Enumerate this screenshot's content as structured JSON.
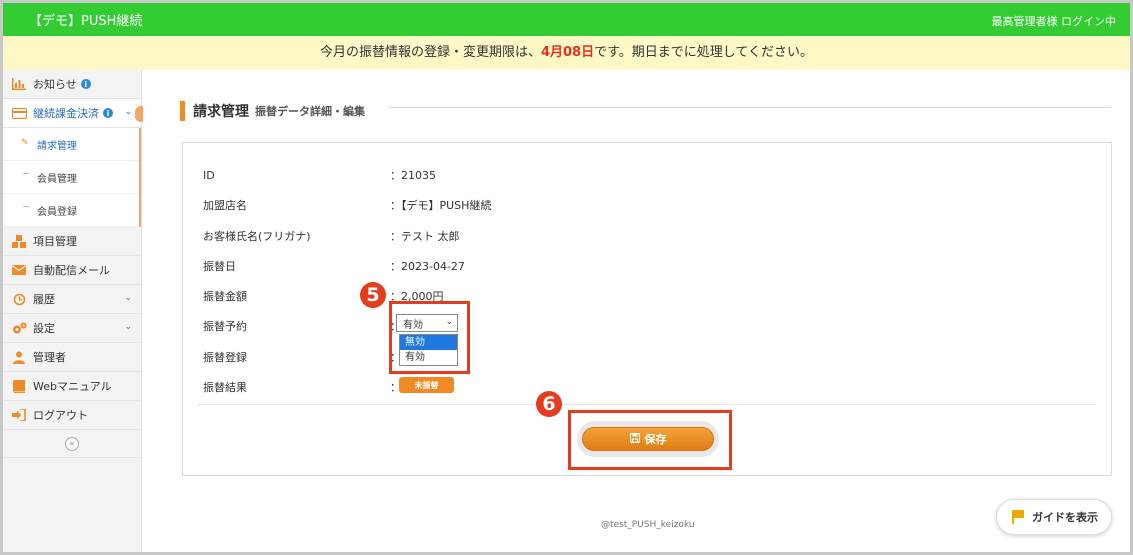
{
  "app": {
    "brand": "【デモ】PUSH継続",
    "login_status": "最高管理者様 ログイン中"
  },
  "notice": {
    "prefix": "今月の振替情報の登録・変更期限は、",
    "deadline": "4月08日",
    "suffix": "です。期日までに処理してください。"
  },
  "sidebar": {
    "items": [
      {
        "label": "お知らせ",
        "icon": "bar-chart-icon"
      },
      {
        "label": "継続課金決済",
        "icon": "credit-card-icon"
      },
      {
        "label": "項目管理",
        "icon": "cubes-icon"
      },
      {
        "label": "自動配信メール",
        "icon": "envelope-icon"
      },
      {
        "label": "履歴",
        "icon": "history-icon"
      },
      {
        "label": "設定",
        "icon": "gears-icon"
      },
      {
        "label": "管理者",
        "icon": "user-icon"
      },
      {
        "label": "Webマニュアル",
        "icon": "book-icon"
      },
      {
        "label": "ログアウト",
        "icon": "sign-out-icon"
      }
    ],
    "submenu": [
      {
        "label": "請求管理"
      },
      {
        "label": "会員管理"
      },
      {
        "label": "会員登録"
      }
    ],
    "collapse": "«"
  },
  "page": {
    "title": "請求管理",
    "subtitle": "振替データ詳細・編集"
  },
  "detail": {
    "rows": [
      {
        "label": "ID",
        "value": "：21035"
      },
      {
        "label": "加盟店名",
        "value": "：【デモ】PUSH継続"
      },
      {
        "label": "お客様氏名(フリガナ)",
        "value": "：テスト 太郎"
      },
      {
        "label": "振替日",
        "value": "：2023-04-27"
      },
      {
        "label": "振替金額",
        "value": "：2,000円"
      },
      {
        "label": "振替予約",
        "value": "："
      },
      {
        "label": "振替登録",
        "value": "："
      },
      {
        "label": "振替結果",
        "value": "："
      }
    ],
    "reservation_select": {
      "selected": "有効",
      "options": [
        "無効",
        "有効"
      ],
      "highlighted": "無効"
    },
    "result_badge": "未振替"
  },
  "actions": {
    "save_label": "保存"
  },
  "annotations": {
    "step5": "5",
    "step6": "6"
  },
  "footer": {
    "text": "@test_PUSH_keizoku",
    "guide_label": "ガイドを表示"
  },
  "colors": {
    "topbar": "#33cc33",
    "notice_bg": "#fdf8c6",
    "accent_orange": "#f08a24",
    "annotation_red": "#e33d1e",
    "link_blue": "#2a6ec0"
  }
}
